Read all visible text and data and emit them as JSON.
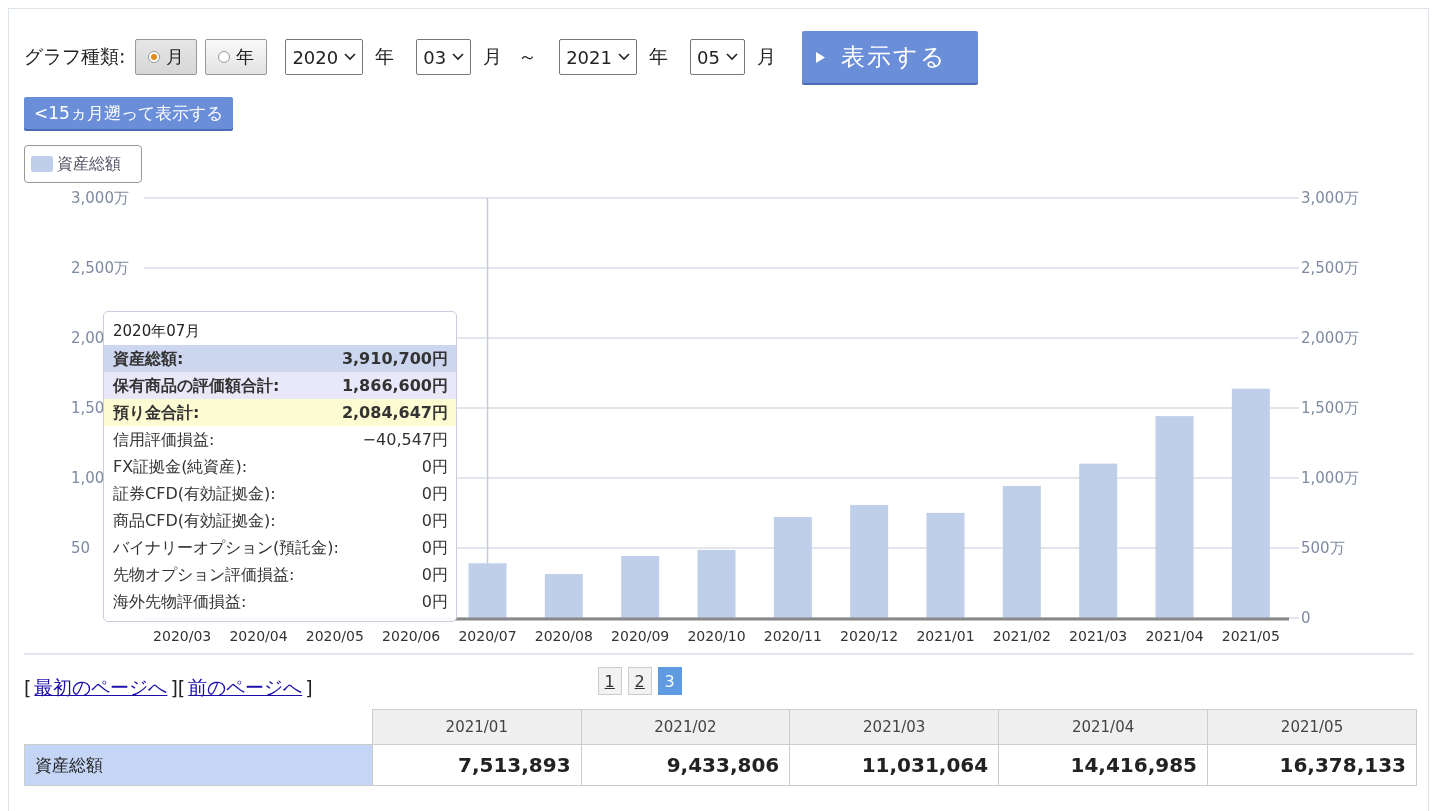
{
  "controls": {
    "graph_type_label": "グラフ種類:",
    "graph_types": [
      {
        "label": "月",
        "selected": true
      },
      {
        "label": "年",
        "selected": false
      }
    ],
    "range": [
      {
        "kind": "select",
        "value": "2020"
      },
      {
        "kind": "unit",
        "text": "年"
      },
      {
        "kind": "select",
        "value": "03"
      },
      {
        "kind": "unit",
        "text": "月"
      },
      {
        "kind": "unit",
        "text": "～"
      },
      {
        "kind": "select",
        "value": "2021"
      },
      {
        "kind": "unit",
        "text": "年"
      },
      {
        "kind": "select",
        "value": "05"
      },
      {
        "kind": "unit",
        "text": "月"
      }
    ],
    "show_button": "表示する",
    "back_button": "<15ヵ月遡って表示する"
  },
  "left_axis_labels": [
    "3,000万",
    "2,500万",
    "2,00",
    "1,50",
    "1,00",
    "50"
  ],
  "chart_data": {
    "type": "bar",
    "grid": true,
    "categories": [
      "2020/03",
      "2020/04",
      "2020/05",
      "2020/06",
      "2020/07",
      "2020/08",
      "2020/09",
      "2020/10",
      "2020/11",
      "2020/12",
      "2021/01",
      "2021/02",
      "2021/03",
      "2021/04",
      "2021/05"
    ],
    "series": [
      {
        "name": "資産総額",
        "color": "#bfcfea",
        "values": [
          null,
          null,
          null,
          null,
          391,
          314,
          443,
          486,
          721,
          807,
          751,
          943,
          1103,
          1442,
          1638
        ]
      }
    ],
    "ylim": [
      0,
      3000
    ],
    "yticks": [
      {
        "value": 0,
        "label": "0"
      },
      {
        "value": 500,
        "label": "500万"
      },
      {
        "value": 1000,
        "label": "1,000万"
      },
      {
        "value": 1500,
        "label": "1,500万"
      },
      {
        "value": 2000,
        "label": "2,000万"
      },
      {
        "value": 2500,
        "label": "2,500万"
      },
      {
        "value": 3000,
        "label": "3,000万"
      }
    ],
    "ref_lines": [
      {
        "axis": "x",
        "value": "2020/07",
        "color": "#c8ccd4"
      }
    ]
  },
  "tooltip": {
    "title": "2020年07月",
    "rows": [
      {
        "label": "資産総額:",
        "value": "3,910,700円",
        "color": "#ccd6ee",
        "bold": true
      },
      {
        "label": "保有商品の評価額合計:",
        "value": "1,866,600円",
        "color": "#e8e8f8",
        "bold": true
      },
      {
        "label": "預り金合計:",
        "value": "2,084,647円",
        "color": "#fdfbd2",
        "bold": true
      },
      {
        "label": "信用評価損益:",
        "value": "−40,547円",
        "bold": false
      },
      {
        "label": "FX証拠金(純資産):",
        "value": "0円",
        "bold": false
      },
      {
        "label": "証券CFD(有効証拠金):",
        "value": "0円",
        "bold": false
      },
      {
        "label": "商品CFD(有効証拠金):",
        "value": "0円",
        "bold": false
      },
      {
        "label": "バイナリーオプション(預託金):",
        "value": "0円",
        "bold": false
      },
      {
        "label": "先物オプション評価損益:",
        "value": "0円",
        "bold": false
      },
      {
        "label": "海外先物評価損益:",
        "value": "0円",
        "bold": false
      }
    ]
  },
  "nav_links": [
    {
      "open": "[",
      "label": "最初のページへ",
      "close": "]"
    },
    {
      "open": "[",
      "label": "前のページへ",
      "close": "]"
    }
  ],
  "pages": [
    {
      "label": "1",
      "selected": false
    },
    {
      "label": "2",
      "selected": false
    },
    {
      "label": "3",
      "selected": true
    }
  ],
  "table": {
    "columns": [
      "2021/01",
      "2021/02",
      "2021/03",
      "2021/04",
      "2021/05"
    ],
    "rows": [
      {
        "label": "資産総額",
        "cells": [
          "7,513,893",
          "9,433,806",
          "11,031,064",
          "14,416,985",
          "16,378,133"
        ]
      }
    ]
  }
}
